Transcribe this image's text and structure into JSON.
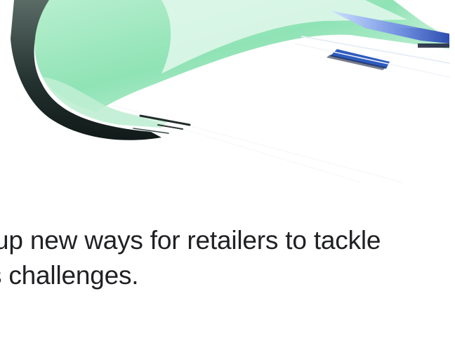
{
  "article": {
    "lines": [
      "up new ways for retailers to tackle",
      "s challenges."
    ]
  },
  "hero": {
    "icon": "abstract-3d-graphic-icon",
    "colors": {
      "mint": "#8fe3b5",
      "mint_light": "#d3f5e2",
      "blue": "#3b63c4",
      "dark": "#1f2a2e"
    }
  }
}
